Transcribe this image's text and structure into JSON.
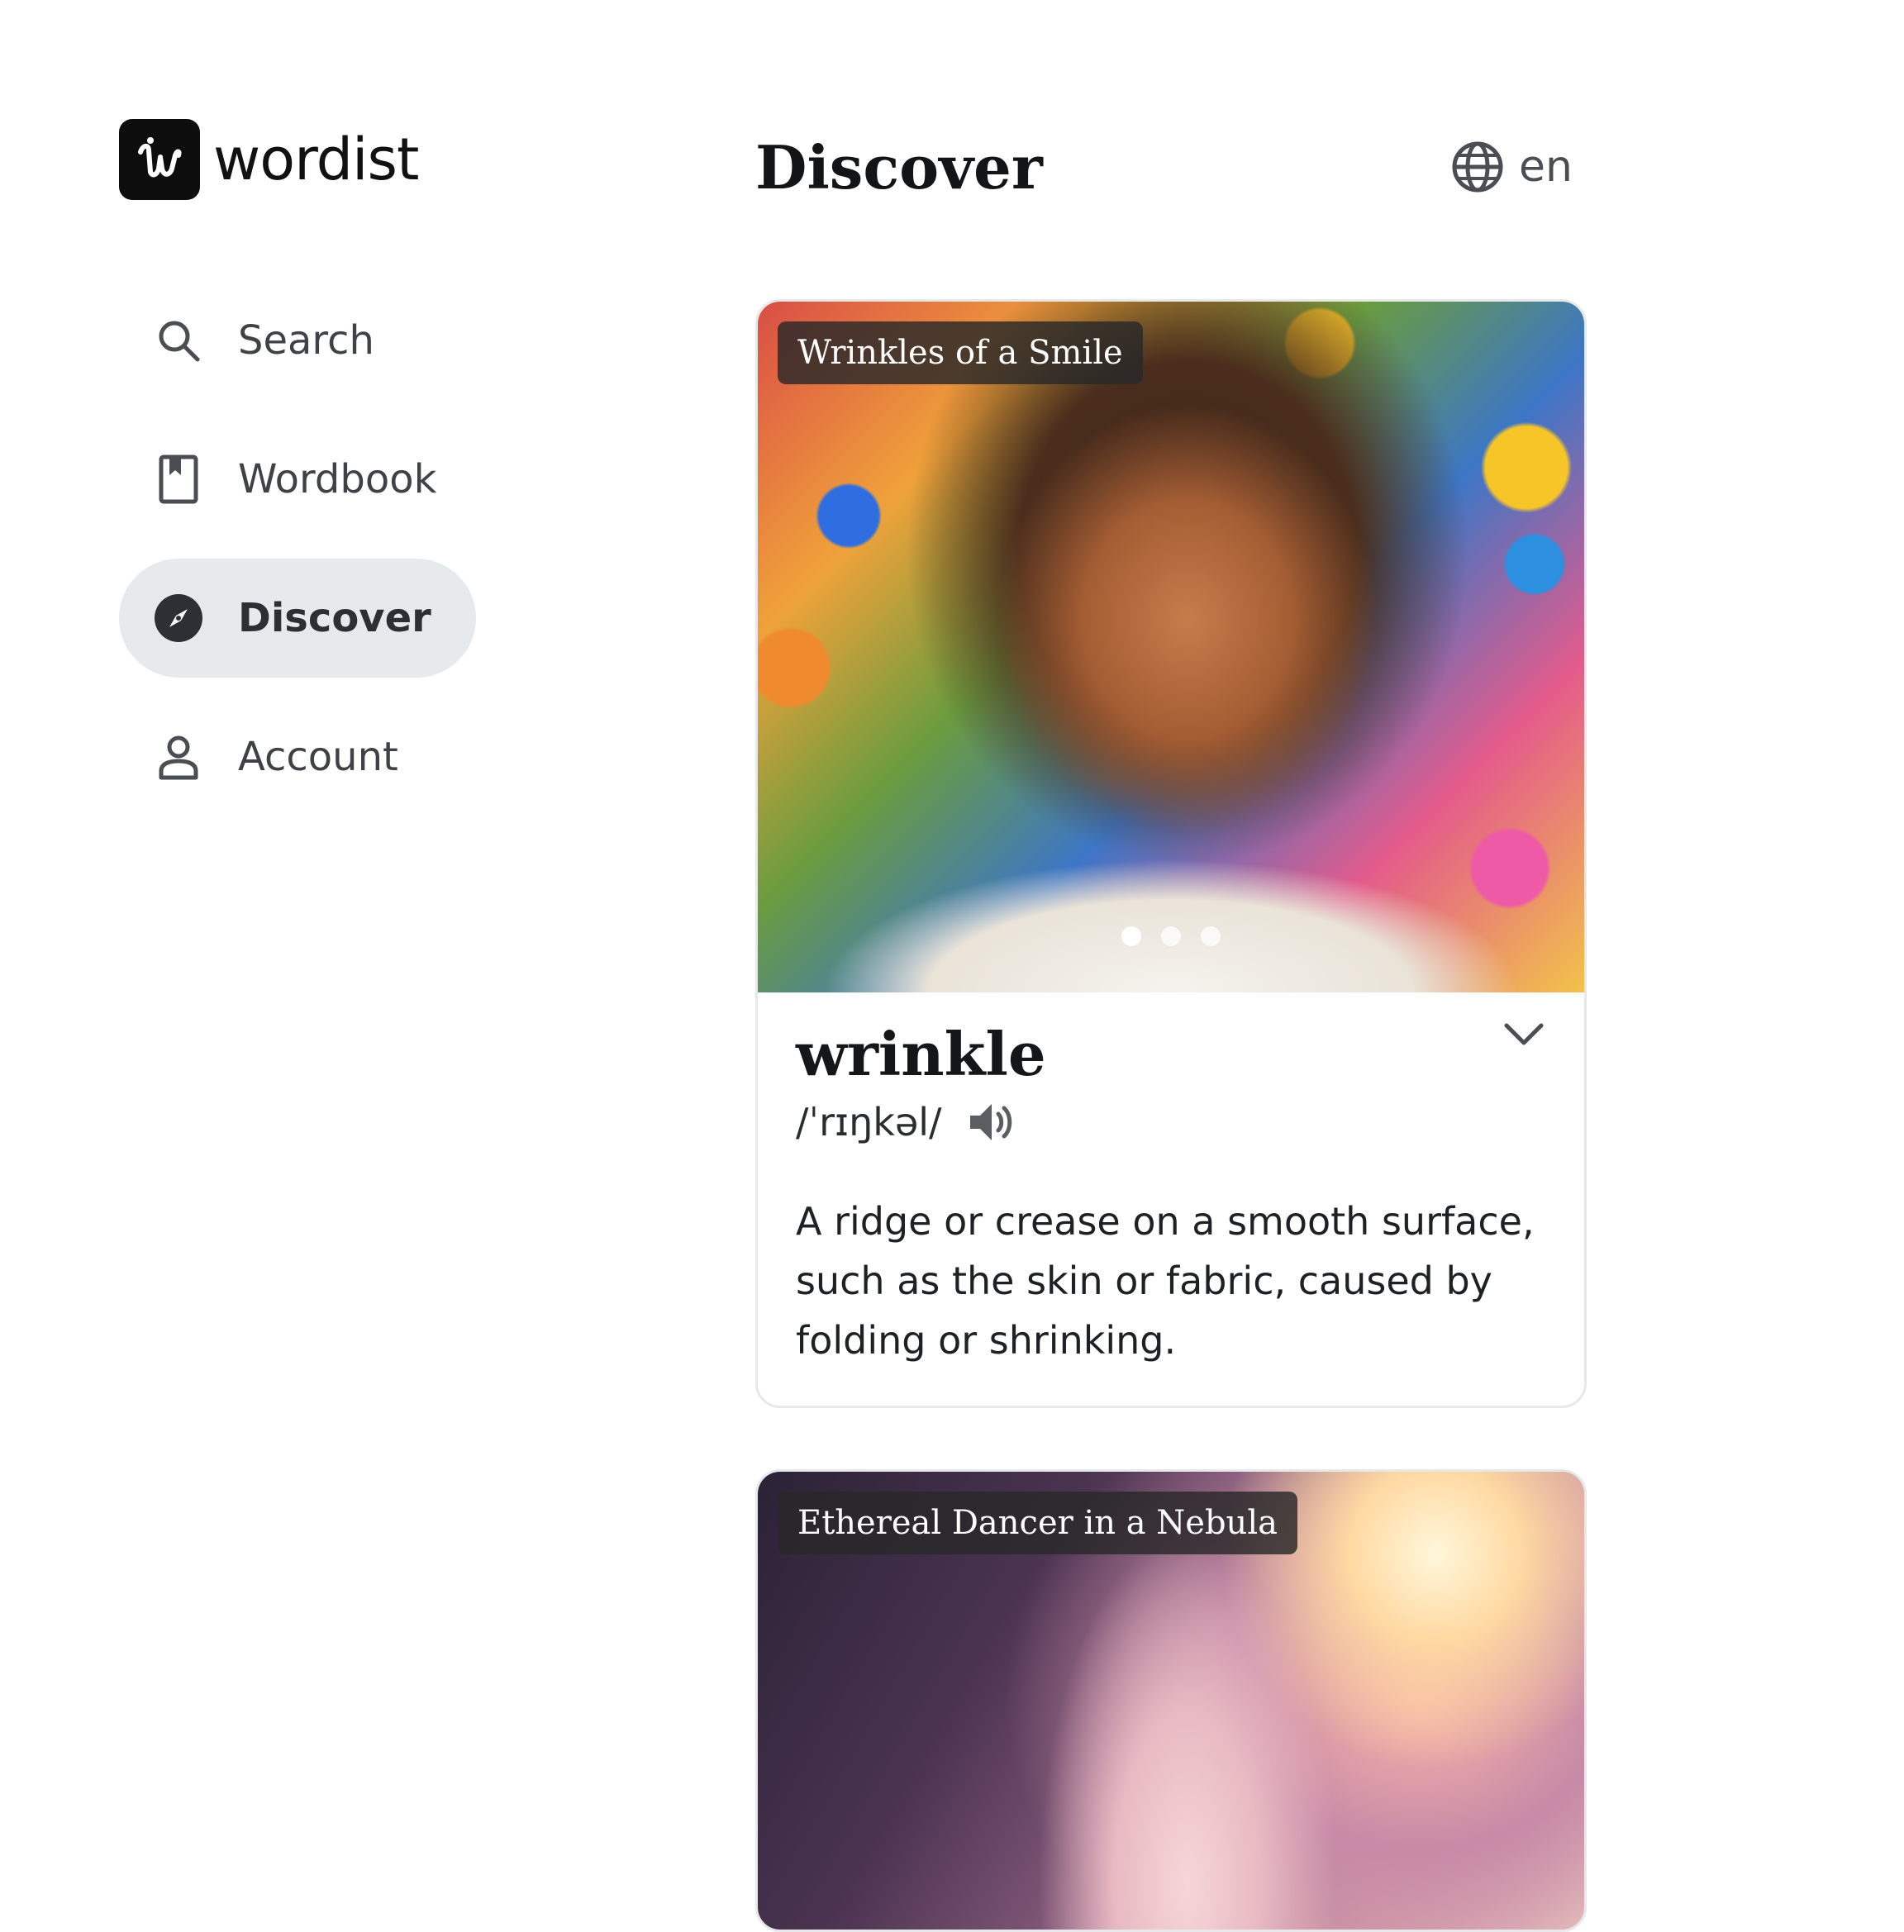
{
  "app": {
    "name": "wordist",
    "logo_letter": "w"
  },
  "sidebar": {
    "items": [
      {
        "label": "Search",
        "icon": "search-icon",
        "active": false
      },
      {
        "label": "Wordbook",
        "icon": "bookmark-book-icon",
        "active": false
      },
      {
        "label": "Discover",
        "icon": "compass-icon",
        "active": true
      },
      {
        "label": "Account",
        "icon": "user-icon",
        "active": false
      }
    ]
  },
  "header": {
    "title": "Discover",
    "language": "en",
    "language_icon": "globe-icon"
  },
  "cards": [
    {
      "image_title": "Wrinkles of a Smile",
      "carousel": {
        "count": 3,
        "active_index": 0
      },
      "word": "wrinkle",
      "pronunciation": "/ˈrɪŋkəl/",
      "definition": "A ridge or crease on a smooth surface, such as the skin or fabric, caused by folding or shrinking."
    },
    {
      "image_title": "Ethereal Dancer in a Nebula"
    }
  ],
  "colors": {
    "active_nav_bg": "#e6eaed",
    "logo_bg": "#0d0d0d",
    "badge_bg": "#282828"
  }
}
